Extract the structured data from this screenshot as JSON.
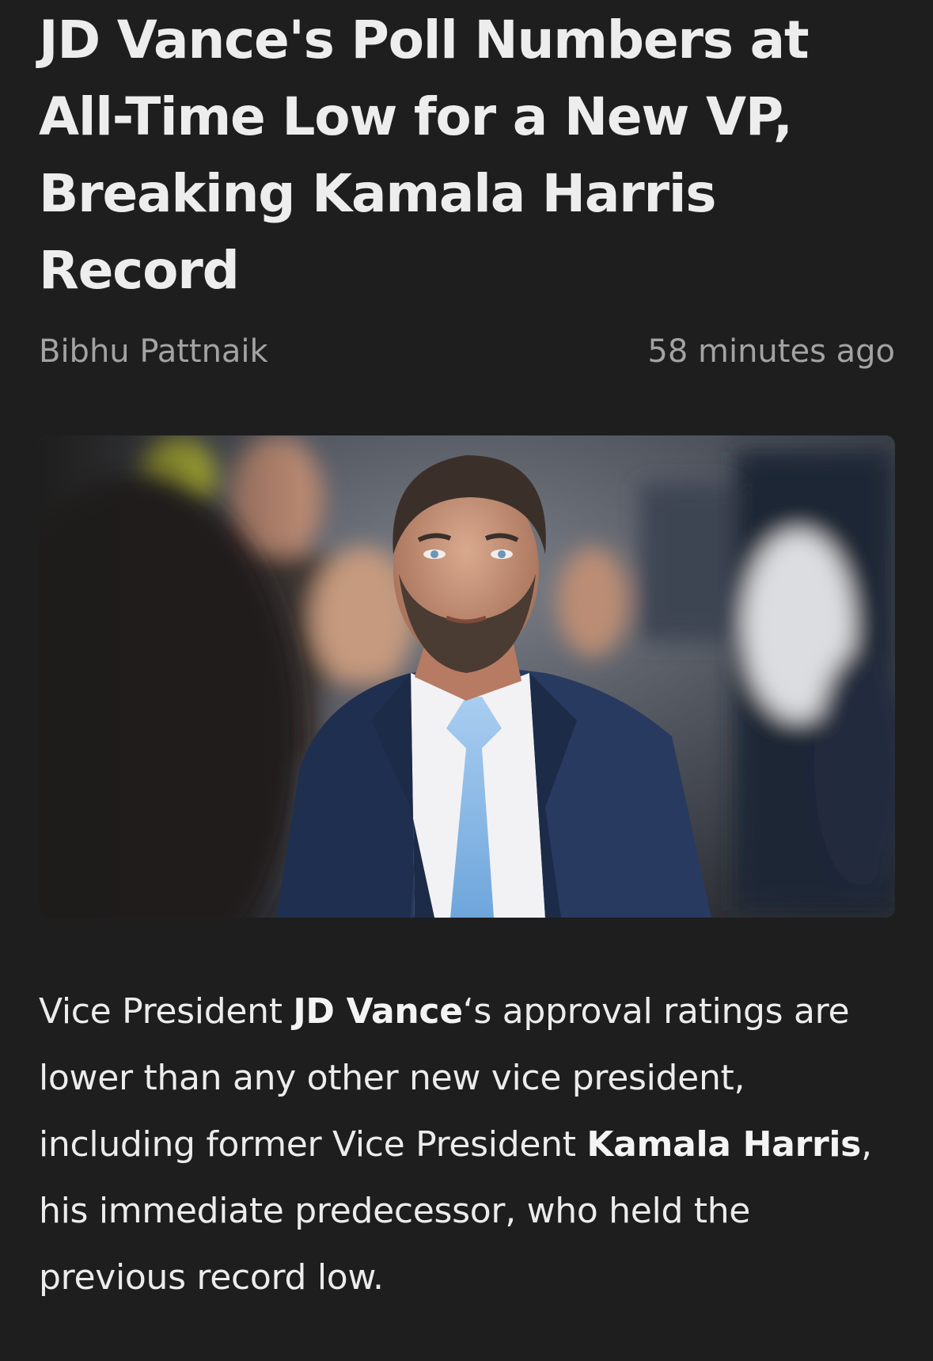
{
  "article": {
    "headline": "JD Vance's Poll Numbers at All-Time Low for a New VP, Breaking Kamala Harris Record",
    "author": "Bibhu Pattnaik",
    "published": "58 minutes ago",
    "image_icon": "photo-of-jd-vance",
    "body": {
      "p1_a": "Vice President ",
      "p1_b": "JD Vance",
      "p1_c": "‘s approval ratings are lower than any other new vice president, including former Vice President ",
      "p1_d": "Kamala Harris",
      "p1_e": ", his immediate predecessor, who held the previous record low."
    }
  },
  "colors": {
    "background": "#1e1e1f",
    "headline": "#ededed",
    "meta": "#a3a3a3",
    "body": "#ececec"
  }
}
